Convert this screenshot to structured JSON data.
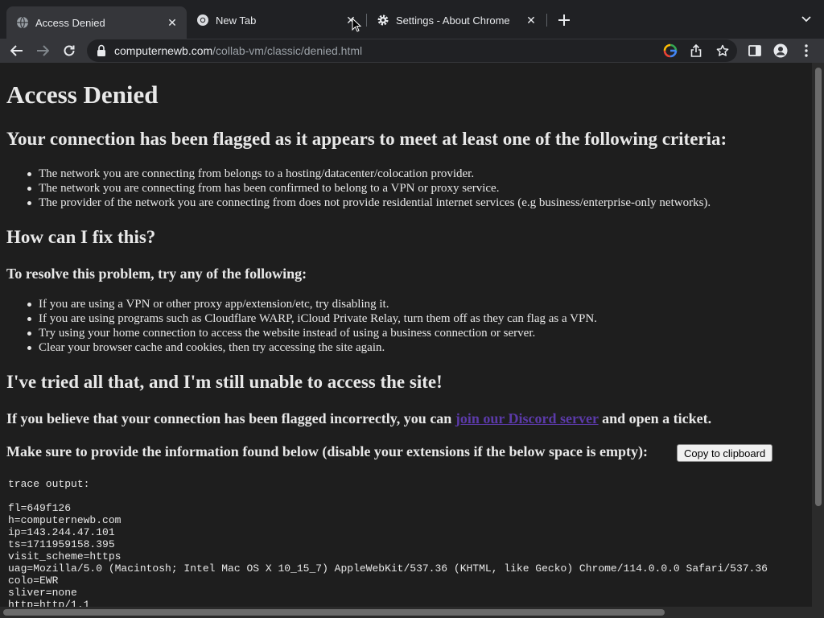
{
  "browser": {
    "tabs": [
      {
        "title": "Access Denied",
        "icon": "globe-icon",
        "active": true
      },
      {
        "title": "New Tab",
        "icon": "chrome-icon",
        "active": false
      },
      {
        "title": "Settings - About Chrome",
        "icon": "gear-icon",
        "active": false
      }
    ],
    "url_host": "computernewb.com",
    "url_path": "/collab-vm/classic/denied.html"
  },
  "page": {
    "title": "Access Denied",
    "flagged_heading": "Your connection has been flagged as it appears to meet at least one of the following criteria:",
    "criteria": [
      "The network you are connecting from belongs to a hosting/datacenter/colocation provider.",
      "The network you are connecting from has been confirmed to belong to a VPN or proxy service.",
      "The provider of the network you are connecting from does not provide residential internet services (e.g business/enterprise-only networks)."
    ],
    "fix_heading": "How can I fix this?",
    "resolve_heading": "To resolve this problem, try any of the following:",
    "fixes": [
      "If you are using a VPN or other proxy app/extension/etc, try disabling it.",
      "If you are using programs such as Cloudflare WARP, iCloud Private Relay, turn them off as they can flag as a VPN.",
      "Try using your home connection to access the website instead of using a business connection or server.",
      "Clear your browser cache and cookies, then try accessing the site again."
    ],
    "still_unable_heading": "I've tried all that, and I'm still unable to access the site!",
    "believe_prefix": "If you believe that your connection has been flagged incorrectly, you can ",
    "discord_link": "join our Discord server",
    "believe_suffix": " and open a ticket.",
    "provide_info": "Make sure to provide the information found below (disable your extensions if the below space is empty):",
    "copy_button": "Copy to clipboard",
    "trace_output": "trace output:\n\nfl=649f126\nh=computernewb.com\nip=143.244.47.101\nts=1711959158.395\nvisit_scheme=https\nuag=Mozilla/5.0 (Macintosh; Intel Mac OS X 10_15_7) AppleWebKit/537.36 (KHTML, like Gecko) Chrome/114.0.0.0 Safari/537.36\ncolo=EWR\nsliver=none\nhttp=http/1.1"
  }
}
